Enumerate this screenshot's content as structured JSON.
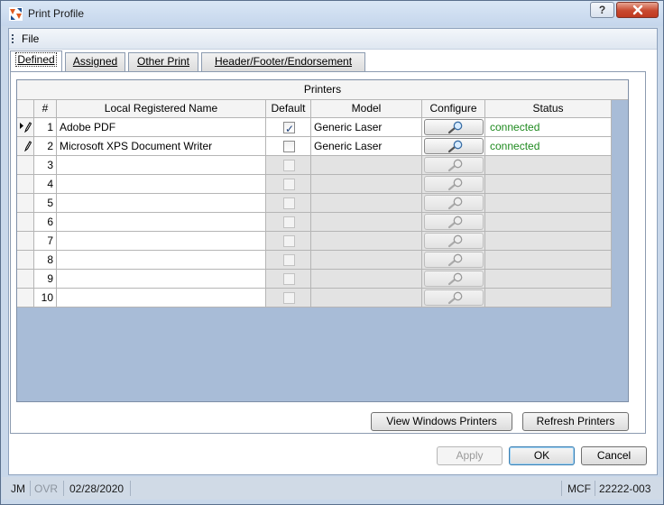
{
  "window": {
    "title": "Print Profile",
    "help_label": "?",
    "close_label": "✕"
  },
  "menu": {
    "file": "File"
  },
  "tabs": [
    {
      "label": "Defined",
      "active": true
    },
    {
      "label": "Assigned"
    },
    {
      "label": "Other Print"
    },
    {
      "label": "Header/Footer/Endorsement"
    }
  ],
  "grid": {
    "caption": "Printers",
    "columns": {
      "num": "#",
      "name": "Local Registered Name",
      "default": "Default",
      "model": "Model",
      "configure": "Configure",
      "status": "Status"
    },
    "rows": [
      {
        "num": "1",
        "name": "Adobe PDF",
        "default": true,
        "model": "Generic Laser",
        "status": "connected"
      },
      {
        "num": "2",
        "name": "Microsoft XPS Document Writer",
        "default": false,
        "model": "Generic Laser",
        "status": "connected"
      },
      {
        "num": "3",
        "name": "",
        "default": false,
        "model": "",
        "status": ""
      },
      {
        "num": "4",
        "name": "",
        "default": false,
        "model": "",
        "status": ""
      },
      {
        "num": "5",
        "name": "",
        "default": false,
        "model": "",
        "status": ""
      },
      {
        "num": "6",
        "name": "",
        "default": false,
        "model": "",
        "status": ""
      },
      {
        "num": "7",
        "name": "",
        "default": false,
        "model": "",
        "status": ""
      },
      {
        "num": "8",
        "name": "",
        "default": false,
        "model": "",
        "status": ""
      },
      {
        "num": "9",
        "name": "",
        "default": false,
        "model": "",
        "status": ""
      },
      {
        "num": "10",
        "name": "",
        "default": false,
        "model": "",
        "status": ""
      }
    ]
  },
  "buttons": {
    "view_windows_printers": "View Windows Printers",
    "refresh_printers": "Refresh Printers",
    "apply": "Apply",
    "ok": "OK",
    "cancel": "Cancel"
  },
  "statusbar": {
    "user": "JM",
    "mode": "OVR",
    "date": "02/28/2020",
    "company": "MCF",
    "code": "22222-003"
  },
  "colors": {
    "status_connected": "#1f8a1f",
    "grid_background": "#a8bcd7",
    "close_button": "#c8492f"
  },
  "icons": {
    "app": "print-profile-app-icon",
    "configure": "magnifier-icon",
    "row_current": "row-selector-edit-icon",
    "row_edit": "pencil-icon"
  }
}
